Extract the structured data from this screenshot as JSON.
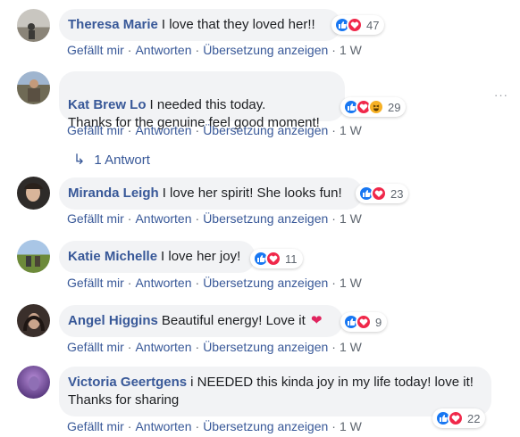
{
  "comments": [
    {
      "author": "Theresa Marie",
      "text": "I love that they loved her!!",
      "reactions": [
        "like",
        "love"
      ],
      "reaction_count": "47",
      "actions": {
        "like": "Gefällt mir",
        "reply": "Antworten",
        "translate": "Übersetzung anzeigen",
        "time": "1 W"
      }
    },
    {
      "author": "Kat Brew Lo",
      "text": "I needed this today.\nThanks for the genuine feel good moment!",
      "reactions": [
        "like",
        "love",
        "haha"
      ],
      "reaction_count": "29",
      "actions": {
        "like": "Gefällt mir",
        "reply": "Antworten",
        "translate": "Übersetzung anzeigen",
        "time": "1 W"
      },
      "replies_label": "1 Antwort"
    },
    {
      "author": "Miranda Leigh",
      "text": "I love her spirit! She looks fun!",
      "reactions": [
        "like",
        "love"
      ],
      "reaction_count": "23",
      "actions": {
        "like": "Gefällt mir",
        "reply": "Antworten",
        "translate": "Übersetzung anzeigen",
        "time": "1 W"
      }
    },
    {
      "author": "Katie Michelle",
      "text": "I love her joy!",
      "reactions": [
        "like",
        "love"
      ],
      "reaction_count": "11",
      "actions": {
        "like": "Gefällt mir",
        "reply": "Antworten",
        "translate": "Übersetzung anzeigen",
        "time": "1 W"
      }
    },
    {
      "author": "Angel Higgins",
      "text": "Beautiful energy! Love it",
      "reactions": [
        "like",
        "love"
      ],
      "reaction_count": "9",
      "actions": {
        "like": "Gefällt mir",
        "reply": "Antworten",
        "translate": "Übersetzung anzeigen",
        "time": "1 W"
      }
    },
    {
      "author": "Victoria Geertgens",
      "text": "i NEEDED this kinda joy in my life today! love it! Thanks for sharing",
      "reactions": [
        "like",
        "love"
      ],
      "reaction_count": "22",
      "actions": {
        "like": "Gefällt mir",
        "reply": "Antworten",
        "translate": "Übersetzung anzeigen",
        "time": "1 W"
      }
    }
  ],
  "colors": {
    "author": "#385898",
    "bubble": "#f2f3f5",
    "like": "#1877f2",
    "love": "#f0284a",
    "haha": "#f7b125",
    "meta": "#606770"
  }
}
